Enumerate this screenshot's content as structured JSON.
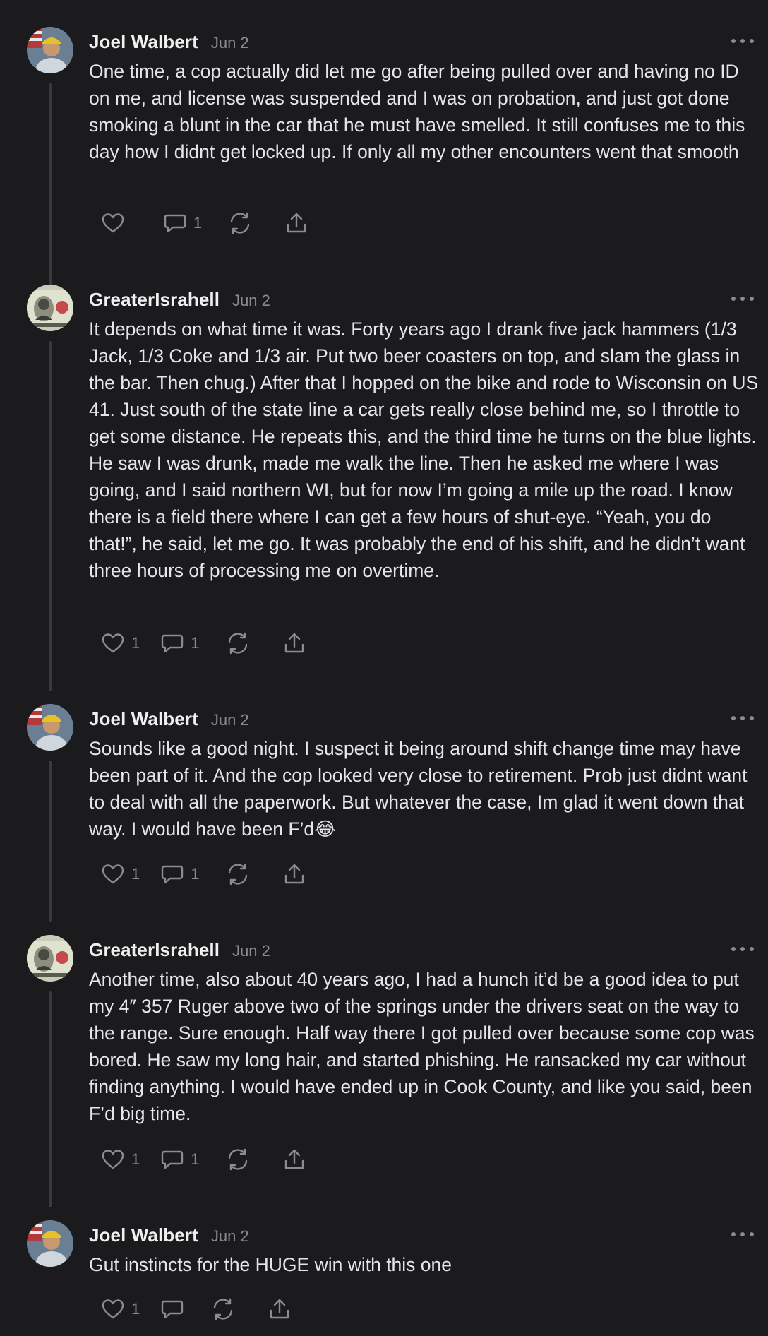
{
  "comments": [
    {
      "author": "Joel Walbert",
      "date": "Jun 2",
      "avatar": "avatar-flag-man",
      "text": "One time, a cop actually did let me go after being pulled over and having no ID on me, and license was suspended and I was on probation, and just got done smoking a blunt in the car that he must have smelled. It still confuses me to this day how I didnt get locked up. If only all my other encounters went that smooth",
      "likes": "",
      "replies": "1"
    },
    {
      "author": "GreaterIsrahell",
      "date": "Jun 2",
      "avatar": "avatar-dollar-bill",
      "text": "It depends on what time it was. Forty years ago I drank five jack hammers (1/3 Jack, 1/3 Coke and 1/3 air. Put two beer coasters on top, and slam the glass in the bar. Then chug.) After that I hopped on the bike and rode to Wisconsin on US 41. Just south of the state line a car gets really close behind me, so I throttle to get some distance. He repeats this, and the third time he turns on the blue lights. He saw I was drunk, made me walk the line. Then he asked me where I was going, and I said northern WI, but for now I’m going a mile up the road. I know there is a field there where I can get a few hours of shut-eye. “Yeah, you do that!”, he said, let me go. It was probably the end of his shift, and he didn’t want three hours of processing me on overtime.",
      "likes": "1",
      "replies": "1"
    },
    {
      "author": "Joel Walbert",
      "date": "Jun 2",
      "avatar": "avatar-flag-man",
      "text": "Sounds like a good night. I suspect it being around shift change time may have been part of it. And the cop looked very close to retirement. Prob just didnt want to deal with all the paperwork. But whatever the case, Im glad it went down that way. I would have been F’d😂",
      "likes": "1",
      "replies": "1"
    },
    {
      "author": "GreaterIsrahell",
      "date": "Jun 2",
      "avatar": "avatar-dollar-bill",
      "text": "Another time, also about 40 years ago, I had a hunch it’d be a good idea to put my 4″ 357 Ruger above two of the springs under the drivers seat on the way to the range. Sure enough. Half way there I got pulled over because some cop was bored. He saw my long hair, and started phishing. He ransacked my car without finding anything. I would have ended up in Cook County, and like you said, been F’d big time.",
      "likes": "1",
      "replies": "1"
    },
    {
      "author": "Joel Walbert",
      "date": "Jun 2",
      "avatar": "avatar-flag-man",
      "text": "Gut instincts for the HUGE win with this one",
      "likes": "1",
      "replies": ""
    }
  ],
  "icons": {
    "like": "heart-icon",
    "reply": "comment-bubble-icon",
    "restack": "restack-icon",
    "share": "share-icon",
    "more": "more-options-icon"
  },
  "colors": {
    "background": "#1b1b1d",
    "text": "#e6e6e8",
    "muted": "#8b8b90",
    "thread_line": "#3a3a3c"
  }
}
